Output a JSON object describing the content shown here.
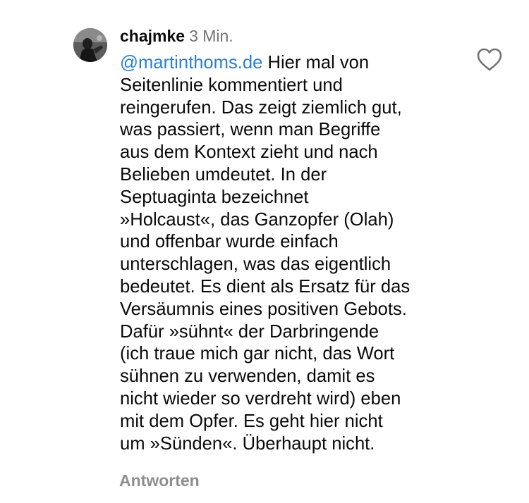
{
  "comment": {
    "username": "chajmke",
    "timestamp": "3 Min.",
    "mention": "@martinthoms.de",
    "first_line_rest": " Hier mal von",
    "lines": [
      "Seitenlinie kommentiert und",
      "reingerufen. Das zeigt ziemlich gut,",
      "was passiert, wenn man Begriffe",
      "aus dem Kontext zieht und nach",
      "Belieben umdeutet. In der",
      "Septuaginta bezeichnet",
      "»Holcaust«, das Ganzopfer (Olah)",
      "und offenbar wurde einfach",
      "unterschlagen, was das eigentlich",
      "bedeutet. Es dient als Ersatz für das",
      "Versäumnis eines positiven Gebots.",
      "Dafür »sühnt« der Darbringende",
      "(ich traue mich gar nicht, das Wort",
      "sühnen zu verwenden, damit es",
      "nicht wieder so verdreht wird) eben",
      "mit dem Opfer. Es geht hier nicht",
      "um »Sünden«. Überhaupt nicht."
    ],
    "reply_label": "Antworten",
    "like_icon": "heart-outline-icon",
    "avatar_icon": "user-avatar"
  },
  "colors": {
    "text": "#0a0a0a",
    "mention": "#2a7fd4",
    "secondary": "#737373",
    "reply": "#8e8e8e",
    "background": "#ffffff"
  }
}
